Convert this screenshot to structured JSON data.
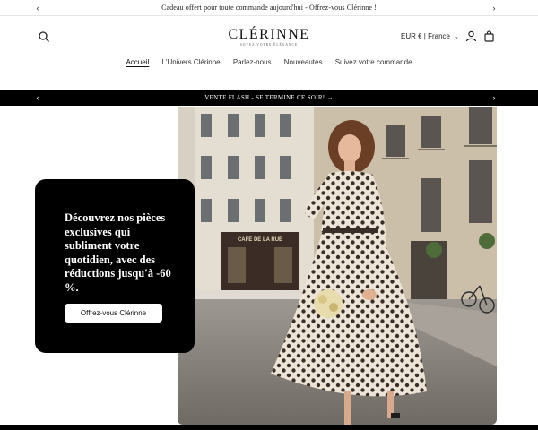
{
  "announcement": {
    "text": "Cadeau offert pour toute commande aujourd'hui - Offrez-vous Clérinne !",
    "prev_icon": "chevron-left-icon",
    "next_icon": "chevron-right-icon"
  },
  "header": {
    "logo_name": "CLÉRINNE",
    "logo_tagline": "SOYEZ VOTRE ÉLÉGANCE",
    "currency": "EUR € | France",
    "icons": [
      "search-icon",
      "user-icon",
      "cart-icon"
    ]
  },
  "nav": {
    "items": [
      {
        "label": "Accueil",
        "active": true
      },
      {
        "label": "L'Univers Clérinne",
        "active": false
      },
      {
        "label": "Parlez-nous",
        "active": false
      },
      {
        "label": "Nouveautés",
        "active": false
      },
      {
        "label": "Suivez votre commande",
        "active": false
      }
    ]
  },
  "flash": {
    "text": "VENTE FLASH - SE TERMINE CE SOIR!",
    "arrow": "→"
  },
  "hero": {
    "heading": "Découvrez nos pièces exclusives qui subliment votre quotidien, avec des réductions jusqu'à -60 %.",
    "cta_label": "Offrez-vous Clérinne",
    "shop_sign": "CAFÉ DE LA RUE"
  },
  "colors": {
    "accent": "#000000",
    "background": "#ffffff",
    "text": "#121212"
  }
}
